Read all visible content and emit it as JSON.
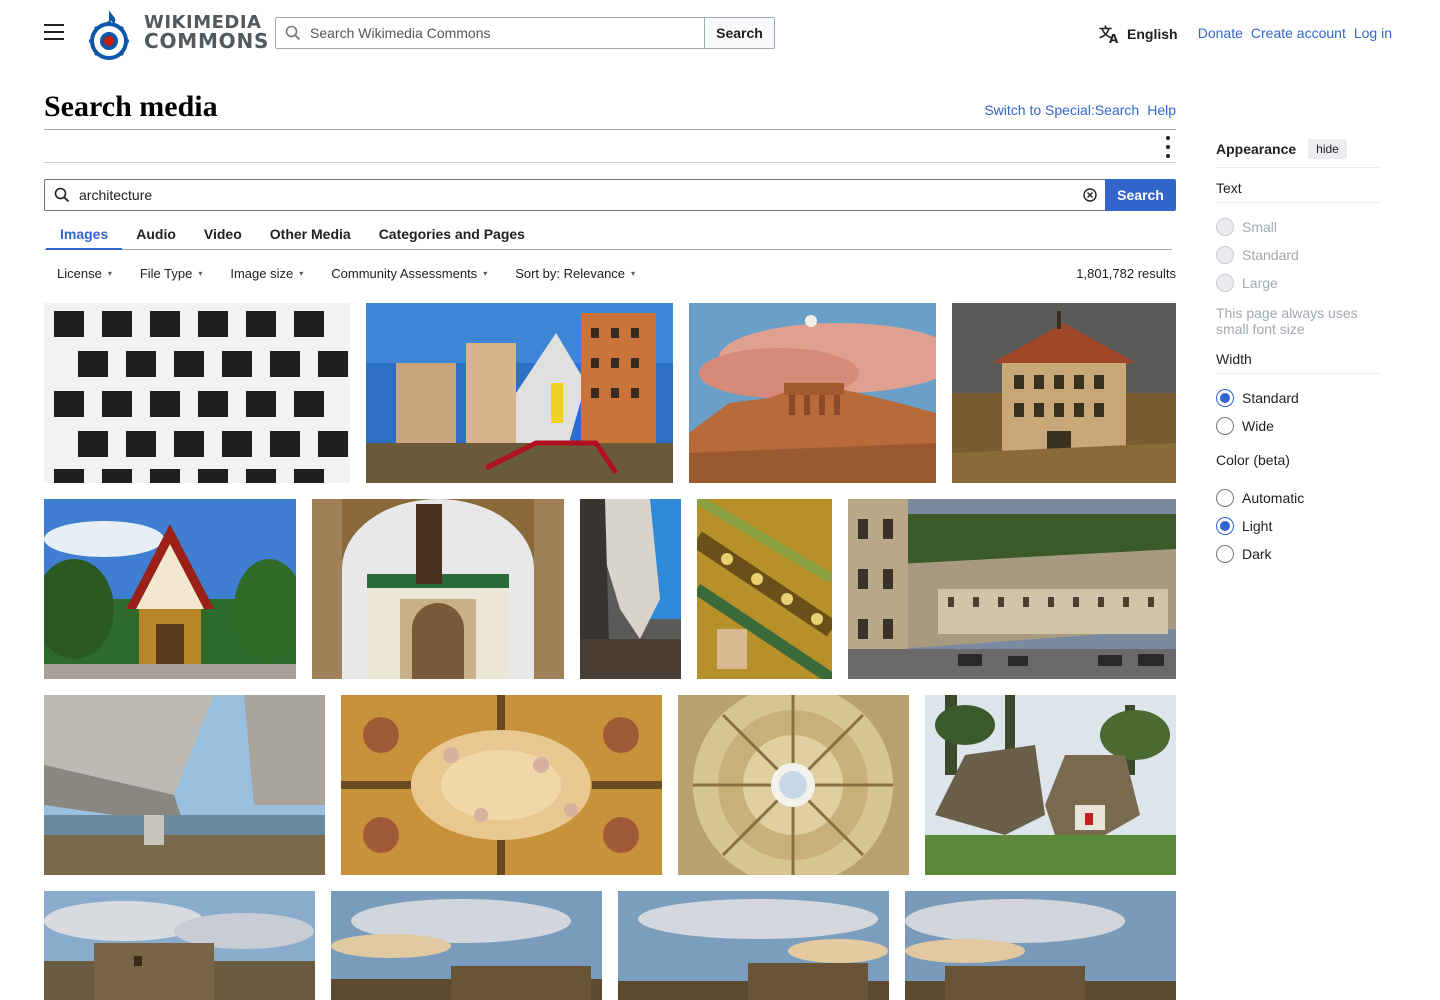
{
  "header": {
    "logo_line1": "WIKIMEDIA",
    "logo_line2": "COMMONS",
    "search_placeholder": "Search Wikimedia Commons",
    "search_button": "Search",
    "language": "English",
    "links": [
      "Donate",
      "Create account",
      "Log in"
    ]
  },
  "page": {
    "title": "Search media",
    "switch_link": "Switch to Special:Search",
    "help_link": "Help"
  },
  "media_search": {
    "query": "architecture",
    "button": "Search"
  },
  "tabs": [
    "Images",
    "Audio",
    "Video",
    "Other Media",
    "Categories and Pages"
  ],
  "active_tab": "Images",
  "filters": [
    "License",
    "File Type",
    "Image size",
    "Community Assessments",
    "Sort by: Relevance"
  ],
  "results_count": "1,801,782 results",
  "appearance": {
    "title": "Appearance",
    "hide": "hide",
    "text_label": "Text",
    "text_options": [
      "Small",
      "Standard",
      "Large"
    ],
    "text_note": "This page always uses small font size",
    "width_label": "Width",
    "width_options": [
      "Standard",
      "Wide"
    ],
    "width_selected": "Standard",
    "color_label": "Color (beta)",
    "color_options": [
      "Automatic",
      "Light",
      "Dark"
    ],
    "color_selected": "Light"
  },
  "colors": {
    "link": "#3366cc",
    "text": "#202122",
    "border": "#a2a9b1"
  },
  "images": [
    {
      "name": "image-modern-facade"
    },
    {
      "name": "image-stata-center"
    },
    {
      "name": "image-acropolis-sunset"
    },
    {
      "name": "image-ornate-villa"
    },
    {
      "name": "image-lao-temple"
    },
    {
      "name": "image-moroccan-arch"
    },
    {
      "name": "image-cave-wall"
    },
    {
      "name": "image-mosaic-ceiling"
    },
    {
      "name": "image-bath-crescent"
    },
    {
      "name": "image-bridge-underside"
    },
    {
      "name": "image-baroque-ceiling"
    },
    {
      "name": "image-dome-oculus"
    },
    {
      "name": "image-rock-dwelling"
    },
    {
      "name": "image-fort-sky-1"
    },
    {
      "name": "image-fort-sky-2"
    },
    {
      "name": "image-fort-sky-3"
    },
    {
      "name": "image-fort-sky-4"
    }
  ]
}
